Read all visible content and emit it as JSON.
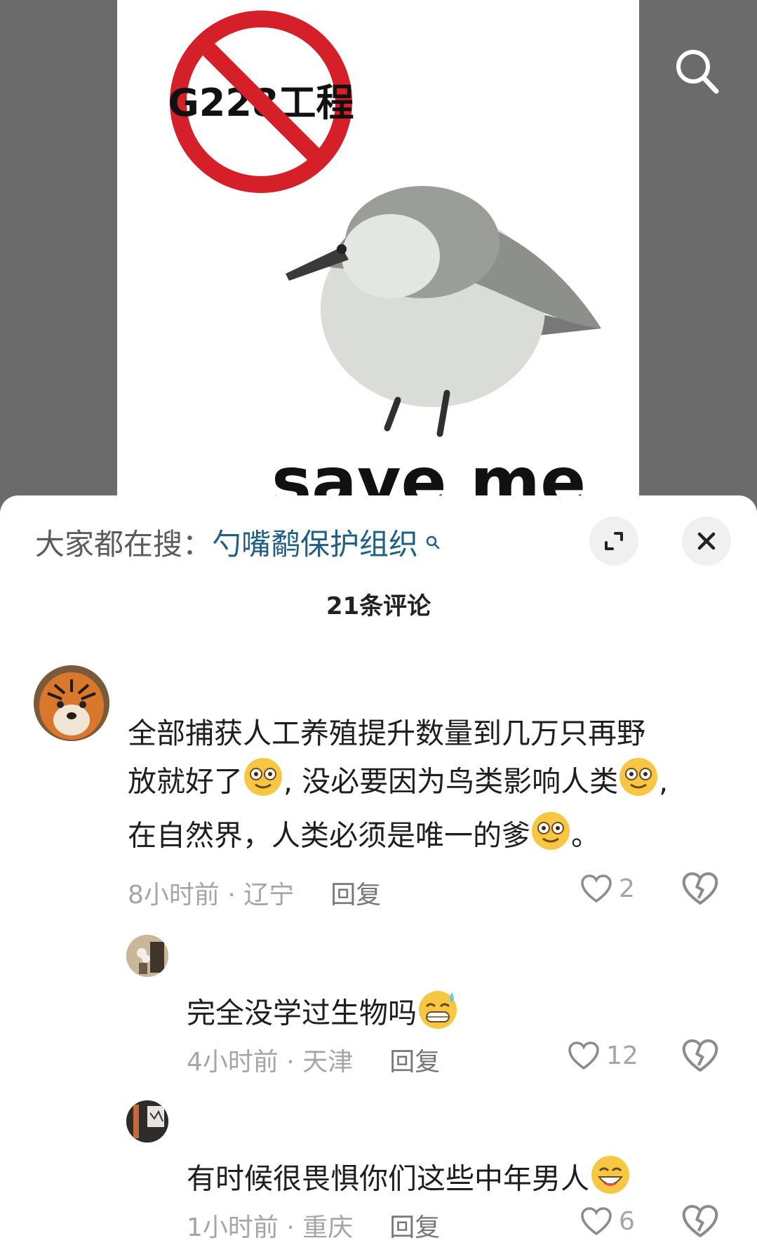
{
  "media": {
    "sign_text": "G228工程",
    "caption_text": "save me"
  },
  "search_icon": "search-icon",
  "panel": {
    "hot_search_prefix": "大家都在搜：",
    "hot_search_term": "勺嘴鹬保护组织",
    "expand_icon": "expand-icon",
    "close_icon": "close-icon",
    "comment_count": "21条评论"
  },
  "comments": [
    {
      "lines": [
        "全部捕获人工养殖提升数量到几万只再野",
        "放就好了",
        ", 没必要因为鸟类影响人类",
        ",",
        "在自然界，人类必须是唯一的爹",
        "。"
      ],
      "time": "8小时前",
      "location": "辽宁",
      "reply_label": "回复",
      "likes": "2"
    },
    {
      "text": "完全没学过生物吗",
      "time": "4小时前",
      "location": "天津",
      "reply_label": "回复",
      "likes": "12"
    },
    {
      "text": "有时候很畏惧你们这些中年男人",
      "time": "1小时前",
      "location": "重庆",
      "reply_label": "回复",
      "likes": "6"
    }
  ],
  "colors": {
    "accent_link": "#1f5f86",
    "prohibition_red": "#d5202a",
    "muted_text": "#a5a5a5",
    "emoji_yellow": "#f7c744"
  }
}
